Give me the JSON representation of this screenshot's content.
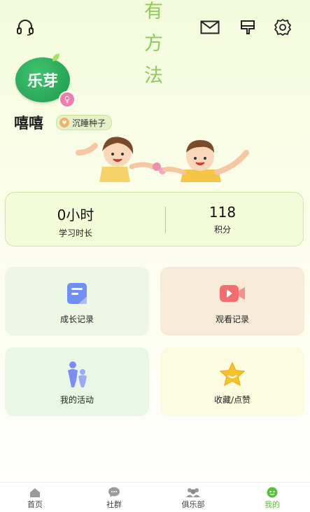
{
  "slogan": [
    "有",
    "方",
    "法"
  ],
  "brand": {
    "logo_text": "乐芽"
  },
  "profile": {
    "username": "嘻嘻",
    "level_badge": "沉睡种子"
  },
  "stats": [
    {
      "value": "0小时",
      "label": "学习时长"
    },
    {
      "value": "118",
      "label": "积分"
    }
  ],
  "tiles": [
    {
      "label": "成长记录",
      "icon": "growth-record-icon"
    },
    {
      "label": "观看记录",
      "icon": "video-record-icon"
    },
    {
      "label": "我的活动",
      "icon": "family-activity-icon"
    },
    {
      "label": "收藏/点赞",
      "icon": "star-icon"
    }
  ],
  "nav": [
    {
      "label": "首页",
      "icon": "home-icon"
    },
    {
      "label": "社群",
      "icon": "chat-icon"
    },
    {
      "label": "俱乐部",
      "icon": "people-icon"
    },
    {
      "label": "我的",
      "icon": "profile-icon",
      "active": true
    }
  ],
  "colors": {
    "accent": "#5bbf3e",
    "logo_green": "#22a452",
    "slogan": "#8ecb5b"
  }
}
